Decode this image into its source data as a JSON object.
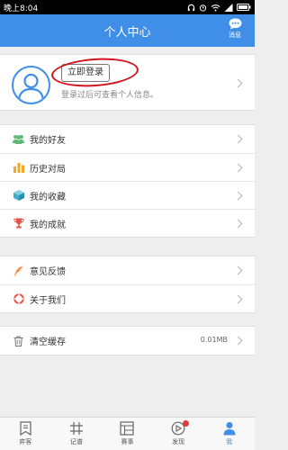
{
  "status_bar": {
    "time": "晚上8:04"
  },
  "header": {
    "title": "个人中心",
    "message_label": "消息"
  },
  "profile": {
    "login_button": "立即登录",
    "hint": "登录过后可查看个人信息。"
  },
  "menu_group_1": [
    {
      "label": "我的好友",
      "icon": "friends-icon",
      "color": "#5bb974"
    },
    {
      "label": "历史对局",
      "icon": "history-bars-icon",
      "color": "#f5a623"
    },
    {
      "label": "我的收藏",
      "icon": "collection-cube-icon",
      "color": "#3fb0c9"
    },
    {
      "label": "我的成就",
      "icon": "trophy-icon",
      "color": "#e2574c"
    }
  ],
  "menu_group_2": [
    {
      "label": "意见反馈",
      "icon": "feedback-quill-icon",
      "color": "#f08c3a"
    },
    {
      "label": "关于我们",
      "icon": "about-lifebuoy-icon",
      "color": "#e2574c"
    }
  ],
  "menu_group_3": [
    {
      "label": "清空缓存",
      "icon": "trash-icon",
      "value": "0.01MB"
    }
  ],
  "tab_bar": [
    {
      "label": "弈客",
      "icon": "bookmark-icon"
    },
    {
      "label": "记谱",
      "icon": "grid-board-icon"
    },
    {
      "label": "赛事",
      "icon": "tournament-icon"
    },
    {
      "label": "发现",
      "icon": "discover-icon",
      "has_dot": true
    },
    {
      "label": "我",
      "icon": "person-icon",
      "active": true
    }
  ],
  "colors": {
    "accent": "#3f8ee8",
    "highlight_oval": "#d4141c",
    "badge": "#e53935"
  }
}
